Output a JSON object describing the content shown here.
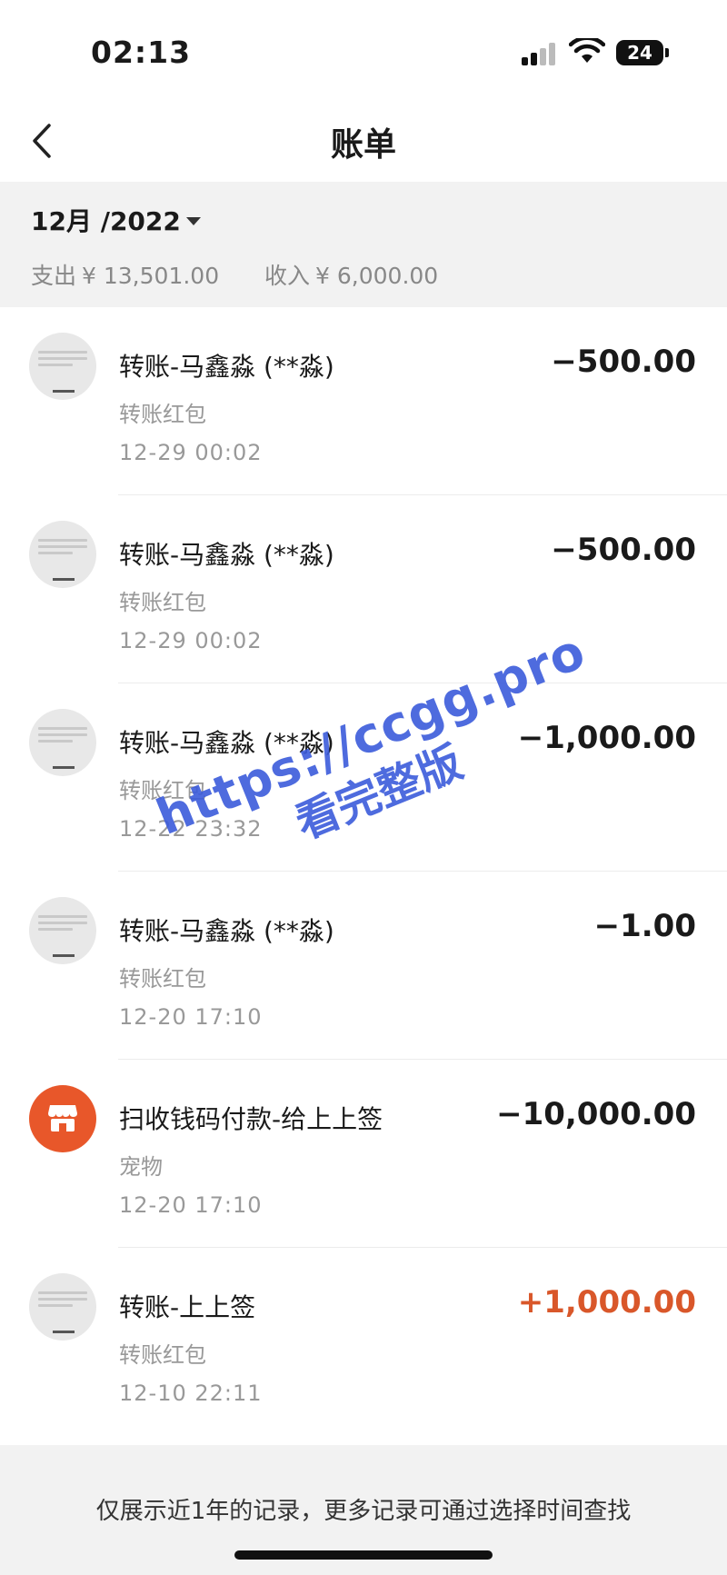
{
  "status_bar": {
    "time": "02:13",
    "battery": "24"
  },
  "nav": {
    "title": "账单"
  },
  "summary": {
    "month": "12月 /2022",
    "expense_label": "支出",
    "expense_value": "¥ 13,501.00",
    "income_label": "收入",
    "income_value": "¥ 6,000.00"
  },
  "records": [
    {
      "title": "转账-马鑫淼 (**淼)",
      "subtitle": "转账红包",
      "time": "12-29  00:02",
      "amount": "−500.00",
      "type": "expense",
      "avatar": "user-avatar"
    },
    {
      "title": "转账-马鑫淼 (**淼)",
      "subtitle": "转账红包",
      "time": "12-29  00:02",
      "amount": "−500.00",
      "type": "expense",
      "avatar": "user-avatar"
    },
    {
      "title": "转账-马鑫淼 (**淼)",
      "subtitle": "转账红包",
      "time": "12-22  23:32",
      "amount": "−1,000.00",
      "type": "expense",
      "avatar": "user-avatar"
    },
    {
      "title": "转账-马鑫淼 (**淼)",
      "subtitle": "转账红包",
      "time": "12-20  17:10",
      "amount": "−1.00",
      "type": "expense",
      "avatar": "user-avatar"
    },
    {
      "title": "扫收钱码付款-给上上签",
      "subtitle": "宠物",
      "time": "12-20  17:10",
      "amount": "−10,000.00",
      "type": "expense",
      "avatar": "shop-icon"
    },
    {
      "title": "转账-上上签",
      "subtitle": "转账红包",
      "time": "12-10  22:11",
      "amount": "+1,000.00",
      "type": "income",
      "avatar": "user-avatar"
    }
  ],
  "footer": {
    "note": "仅展示近1年的记录，更多记录可通过选择时间查找"
  },
  "watermark": {
    "url": "https://ccgg.pro",
    "text": "看完整版"
  },
  "colors": {
    "income": "#d9572a",
    "shop": "#e8572a",
    "watermark": "#3b5bdb"
  }
}
